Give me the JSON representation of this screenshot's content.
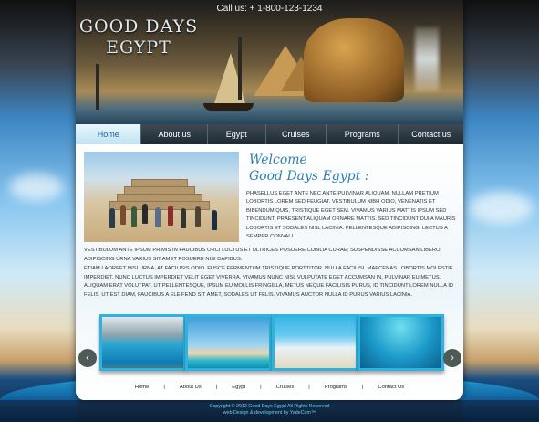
{
  "header": {
    "phone": "Call us: + 1-800-123-1234",
    "logo_line1": "GOOD DAYS",
    "logo_line2": "EGYPT"
  },
  "nav": {
    "items": [
      {
        "label": "Home",
        "active": true
      },
      {
        "label": "About us"
      },
      {
        "label": "Egypt"
      },
      {
        "label": "Cruises"
      },
      {
        "label": "Programs"
      },
      {
        "label": "Contact us"
      }
    ]
  },
  "main": {
    "welcome_line1": "Welcome",
    "welcome_line2": "Good Days Egypt :",
    "intro_paragraph": "Phasellus eget ante nec ante pulvinar aliquam. Nullam pretium lobortis lorem sed feugiat. Vestibulum nibh odio, venenatis et bibendum quis, tristique eget sem. Vivamus varius mattis ipsum sed tincidunt. Praesent aliquam ornare mattis. Sed tincidunt dui a mauris lobortis et sodales nisl lacinia. Pellentesque adipiscing, lectus a semper convall.",
    "paragraph_2": "Vestibulum ante ipsum primis in faucibus orci luctus et ultrices posuere cubilia curae; Suspendisse accumsan libero adipiscing urna varius sit amet posuere nisi dapibus.",
    "paragraph_3": "Etiam laoreet nisi urna, at facilisis odio. Fusce fermentum tristique porttitor. Nulla facilisi. Maecenas lobortis molestie imperdiet. Nunc luctus imperdiet velit eget viverra. Vivamus nunc nisl vulputate eget accumsan in, pulvinar eu metus. Aliquam erat volutpat. Ut pellentesque, ipsum eu mollis fringilla, metus neque facilisis purus, id tincidunt lorem nulla id felis. Ut est diam, faucibus a eleifend sit amet, sodales ut felis. Vivamus auctor nulla id purus varius lacinia."
  },
  "gallery": {
    "prev_icon": "‹",
    "next_icon": "›"
  },
  "footer": {
    "links": [
      "Home",
      "About Us",
      "Egypt",
      "Cruises",
      "Programs",
      "Contact Us"
    ],
    "separator": "|",
    "copyright": "Copyright © 2012 Good Days Egypt All Rights Reserved",
    "credit": "web Design & development by YadeCom™"
  }
}
